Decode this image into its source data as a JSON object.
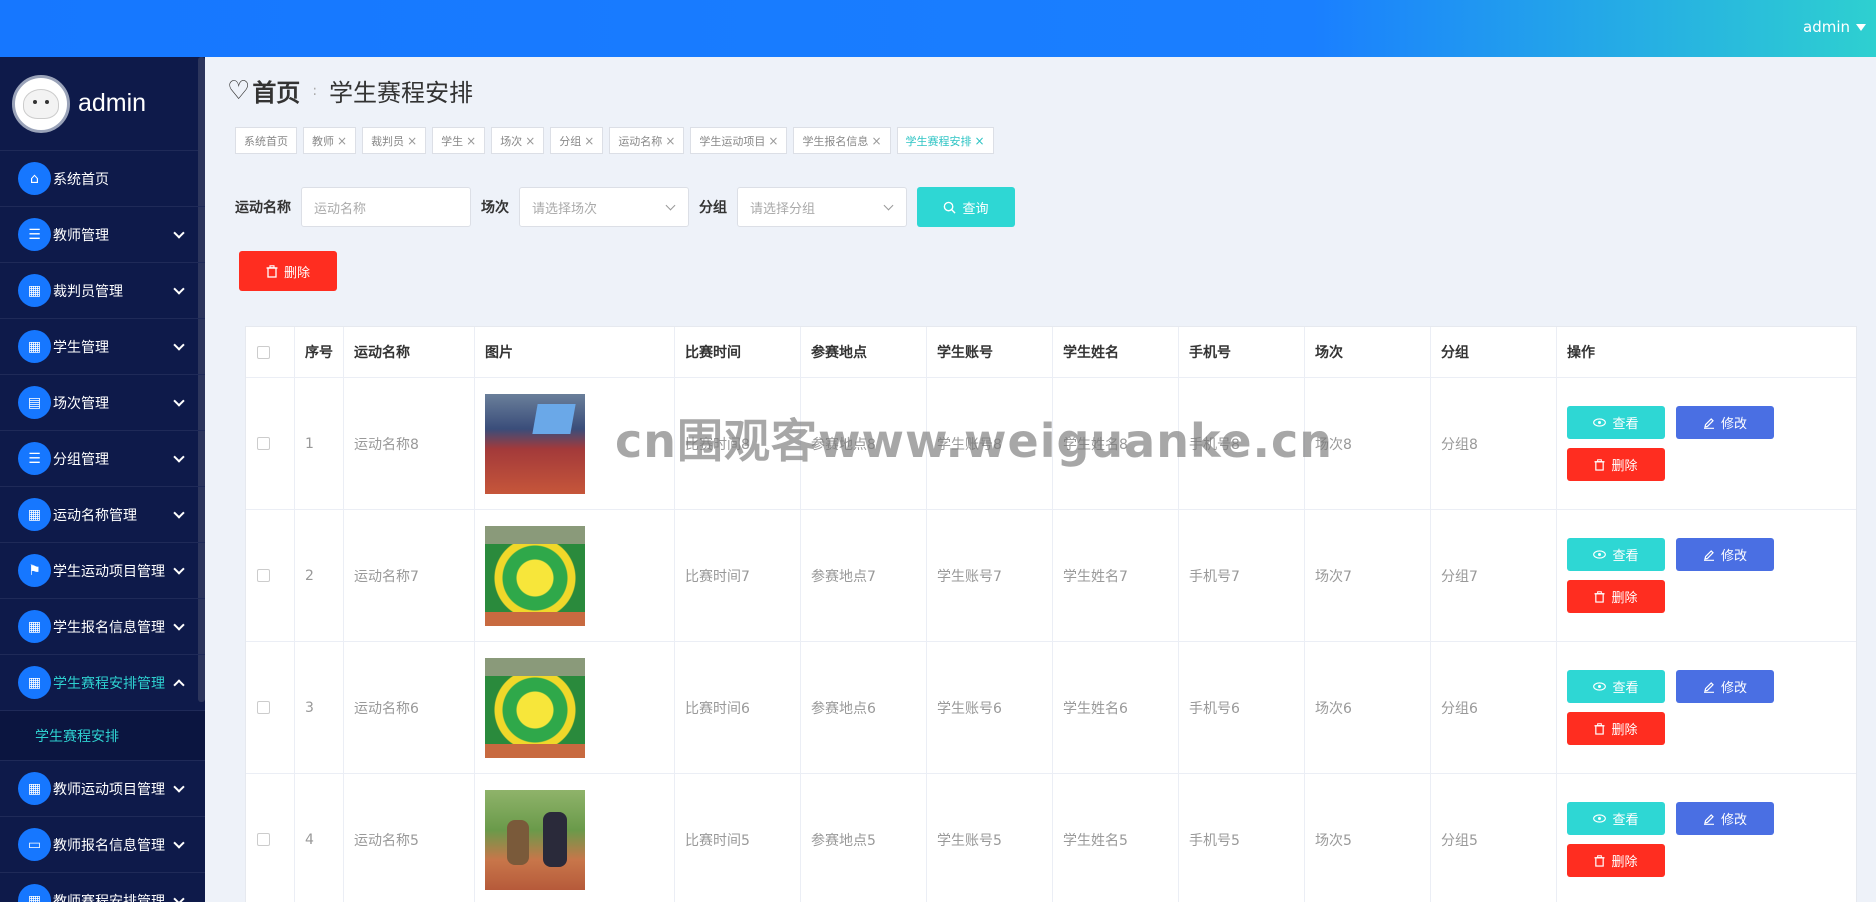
{
  "topbar": {
    "user": "admin"
  },
  "sidebar": {
    "username": "admin",
    "items": [
      {
        "label": "系统首页",
        "icon": "home-icon",
        "expandable": false
      },
      {
        "label": "教师管理",
        "icon": "list-icon",
        "expandable": true
      },
      {
        "label": "裁判员管理",
        "icon": "grid-icon",
        "expandable": true
      },
      {
        "label": "学生管理",
        "icon": "grid-icon",
        "expandable": true
      },
      {
        "label": "场次管理",
        "icon": "chat-icon",
        "expandable": true
      },
      {
        "label": "分组管理",
        "icon": "list-icon",
        "expandable": true
      },
      {
        "label": "运动名称管理",
        "icon": "grid-icon",
        "expandable": true
      },
      {
        "label": "学生运动项目管理",
        "icon": "flag-icon",
        "expandable": true
      },
      {
        "label": "学生报名信息管理",
        "icon": "grid-icon",
        "expandable": true
      },
      {
        "label": "学生赛程安排管理",
        "icon": "grid-icon",
        "expandable": true,
        "active": true
      },
      {
        "label": "教师运动项目管理",
        "icon": "grid-icon",
        "expandable": true
      },
      {
        "label": "教师报名信息管理",
        "icon": "monitor-icon",
        "expandable": true
      },
      {
        "label": "教师赛程安排管理",
        "icon": "grid-icon",
        "expandable": true
      }
    ],
    "submenu": {
      "label": "学生赛程安排"
    }
  },
  "page": {
    "home": "首页",
    "separator": ":",
    "current": "学生赛程安排"
  },
  "tags": [
    {
      "label": "系统首页",
      "closable": false
    },
    {
      "label": "教师",
      "closable": true
    },
    {
      "label": "裁判员",
      "closable": true
    },
    {
      "label": "学生",
      "closable": true
    },
    {
      "label": "场次",
      "closable": true
    },
    {
      "label": "分组",
      "closable": true
    },
    {
      "label": "运动名称",
      "closable": true
    },
    {
      "label": "学生运动项目",
      "closable": true
    },
    {
      "label": "学生报名信息",
      "closable": true
    },
    {
      "label": "学生赛程安排",
      "closable": true,
      "active": true
    }
  ],
  "filters": {
    "sport_label": "运动名称",
    "sport_placeholder": "运动名称",
    "session_label": "场次",
    "session_placeholder": "请选择场次",
    "group_label": "分组",
    "group_placeholder": "请选择分组",
    "query_button": "查询"
  },
  "delete_button": "删除",
  "table": {
    "columns": [
      "序号",
      "运动名称",
      "图片",
      "比赛时间",
      "参赛地点",
      "学生账号",
      "学生姓名",
      "手机号",
      "场次",
      "分组",
      "操作"
    ],
    "rows": [
      {
        "index": "1",
        "sport": "运动名称8",
        "time": "比赛时间8",
        "place": "参赛地点8",
        "account": "学生账号8",
        "name": "学生姓名8",
        "phone": "手机号8",
        "session": "场次8",
        "group": "分组8"
      },
      {
        "index": "2",
        "sport": "运动名称7",
        "time": "比赛时间7",
        "place": "参赛地点7",
        "account": "学生账号7",
        "name": "学生姓名7",
        "phone": "手机号7",
        "session": "场次7",
        "group": "分组7"
      },
      {
        "index": "3",
        "sport": "运动名称6",
        "time": "比赛时间6",
        "place": "参赛地点6",
        "account": "学生账号6",
        "name": "学生姓名6",
        "phone": "手机号6",
        "session": "场次6",
        "group": "分组6"
      },
      {
        "index": "4",
        "sport": "运动名称5",
        "time": "比赛时间5",
        "place": "参赛地点5",
        "account": "学生账号5",
        "name": "学生姓名5",
        "phone": "手机号5",
        "session": "场次5",
        "group": "分组5"
      }
    ],
    "actions": {
      "view": "查看",
      "edit": "修改",
      "delete": "删除"
    }
  },
  "watermark": "cn围观客www.weiguanke.cn",
  "colors": {
    "accent": "#2ed7d4",
    "primary": "#1677ff",
    "danger": "#ff2d20",
    "edit": "#4a6fe3",
    "sidebar": "#0e1a4a"
  }
}
